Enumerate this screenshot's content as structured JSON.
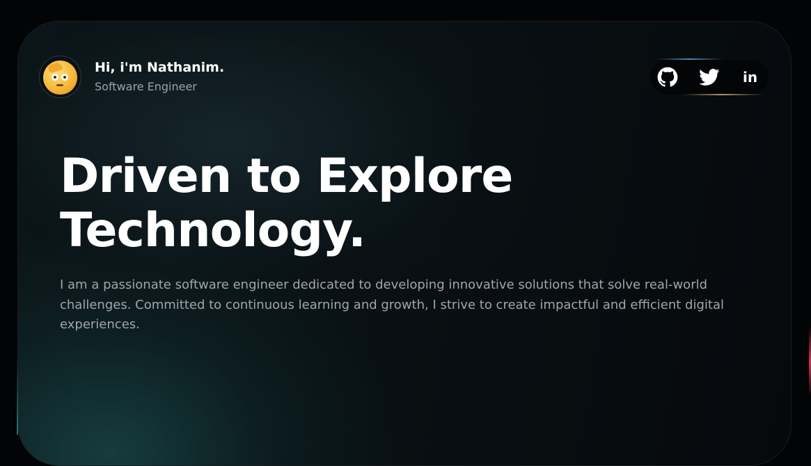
{
  "profile": {
    "name": "Hi, i'm Nathanim.",
    "role": "Software Engineer",
    "avatar_icon": "emoji-face-icon"
  },
  "social": {
    "github_icon": "github-icon",
    "twitter_icon": "twitter-icon",
    "linkedin_label": "in"
  },
  "hero": {
    "headline_line1": "Driven to Explore",
    "headline_line2": "Technology.",
    "intro": "I am a passionate software engineer dedicated to developing innovative solutions that solve real-world challenges. Committed to continuous learning and growth, I strive to create impactful and efficient digital experiences."
  },
  "colors": {
    "background": "#030405",
    "card": "#0a1215",
    "accent_teal": "#1a4a4a",
    "accent_pink": "#ff466e",
    "text_primary": "#ffffff",
    "text_secondary": "#a0a6ab"
  }
}
